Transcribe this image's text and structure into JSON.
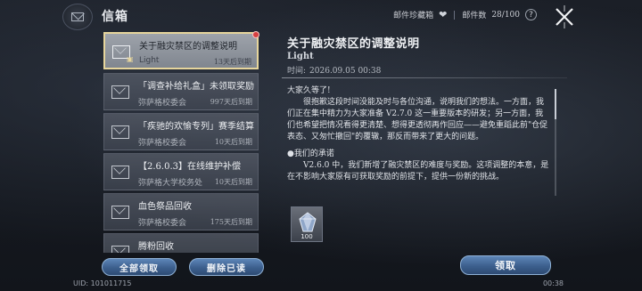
{
  "header": {
    "title": "信箱",
    "collection_label": "邮件珍藏箱",
    "mail_count_label": "邮件数",
    "mail_count_value": "28/100",
    "help_glyph": "?"
  },
  "mails": [
    {
      "subject": "关于融灾禁区的调整说明",
      "sender": "Light",
      "expiry": "13天后到期",
      "selected": true,
      "has_gift": true,
      "unread": true
    },
    {
      "subject": "「调查补给礼盒」未领取奖励",
      "sender": "弥萨格校委会",
      "expiry": "997天后到期",
      "selected": false
    },
    {
      "subject": "「疾驰的欢愉专列」赛季结算",
      "sender": "弥萨格校委会",
      "expiry": "10天后到期",
      "selected": false
    },
    {
      "subject": "【2.6.0.3】在线维护补偿",
      "sender": "弥萨格大学校务处",
      "expiry": "10天后到期",
      "selected": false
    },
    {
      "subject": "血色祭品回收",
      "sender": "弥萨格校委会",
      "expiry": "175天后到期",
      "selected": false
    },
    {
      "subject": "腾粉回收",
      "sender": "",
      "expiry": "",
      "selected": false
    }
  ],
  "list_actions": {
    "claim_all": "全部领取",
    "delete_read": "删除已读"
  },
  "footer": {
    "uid": "UID: 101011715",
    "time": "00:38"
  },
  "detail": {
    "title": "关于融灾禁区的调整说明",
    "sender": "Light",
    "time_label": "时间:",
    "time_value": "2026.09.05 00:38",
    "greeting": "大家久等了!",
    "paragraph1": "很抱歉这段时间没能及时与各位沟通，说明我们的想法。一方面，我们正在集中精力为大家准备 V2.7.0 这一重要版本的研发；另一方面，我们也希望把情况看得更清楚、想得更透彻再作回应——避免重蹈此前\"仓促表态、又匆忙撤回\"的覆辙，那反而带来了更大的问题。",
    "section_heading": "●我们的承诺",
    "paragraph2": "V2.6.0 中，我们新增了融灾禁区的难度与奖励。这项调整的本意，是在不影响大家原有可获取奖励的前提下，提供一份新的挑战。",
    "reward_count": "100",
    "claim_button": "领取"
  }
}
